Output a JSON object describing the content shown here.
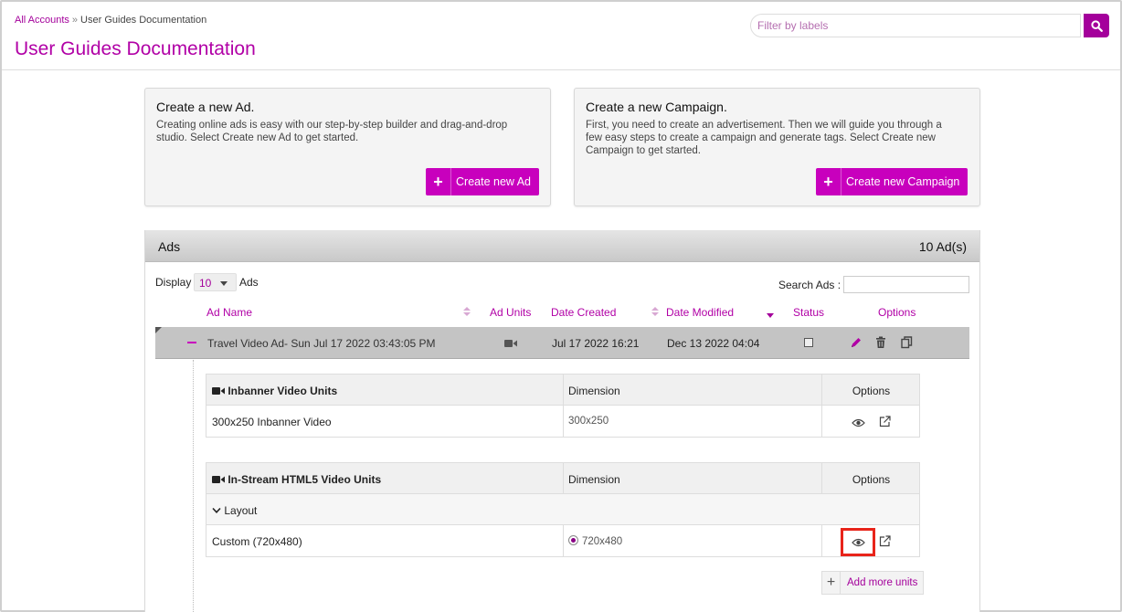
{
  "breadcrumb": {
    "root": "All Accounts",
    "separator": "»",
    "current": "User Guides Documentation"
  },
  "page_title": "User Guides Documentation",
  "filter": {
    "placeholder": "Filter by labels",
    "value": "",
    "search_icon": "search-icon"
  },
  "cards": {
    "ad": {
      "title": "Create a new Ad.",
      "text_line1": "Creating online ads is easy with our step-by-step builder and drag-and-drop",
      "text_line2": "studio. Select Create new Ad to get started.",
      "button": "Create new Ad",
      "button_icon": "+"
    },
    "campaign": {
      "title": "Create a new Campaign.",
      "text_line1": "First, you need to create an advertisement. Then we will guide you through a",
      "text_line2": "few easy steps to create a campaign and generate tags. Select Create new",
      "text_line3": "Campaign to get started.",
      "button": "Create new Campaign",
      "button_icon": "+"
    }
  },
  "ads_panel": {
    "title": "Ads",
    "count": "10 Ad(s)",
    "display_label": "Display",
    "display_value": "10",
    "display_suffix": "Ads",
    "search_label": "Search Ads :",
    "columns": {
      "name": "Ad Name",
      "units": "Ad Units",
      "created": "Date Created",
      "modified": "Date Modified",
      "status": "Status",
      "options": "Options"
    },
    "row": {
      "collapse_icon": "minus-icon",
      "name": "Travel Video Ad- Sun Jul 17 2022 03:43:05 PM",
      "unit_icon": "video-camera-icon",
      "created": "Jul 17 2022 16:21",
      "modified": "Dec 13 2022 04:04",
      "status_checked": false,
      "actions": [
        "edit-pencil-icon",
        "trash-icon",
        "copy-icon"
      ]
    }
  },
  "inbanner": {
    "header": "Inbanner Video Units",
    "dimension_header": "Dimension",
    "options_header": "Options",
    "rows": [
      {
        "name": "300x250 Inbanner Video",
        "dimension": "300x250"
      }
    ]
  },
  "instream": {
    "header": "In-Stream HTML5 Video Units",
    "dimension_header": "Dimension",
    "options_header": "Options",
    "group": "Layout",
    "rows": [
      {
        "name": "Custom (720x480)",
        "dimension": "720x480",
        "radio_selected": true
      }
    ]
  },
  "add_more": {
    "icon": "+",
    "label": "Add more units"
  },
  "colors": {
    "accent": "#c800bd",
    "accent_text": "#b100a6",
    "highlight": "#e8241a"
  }
}
